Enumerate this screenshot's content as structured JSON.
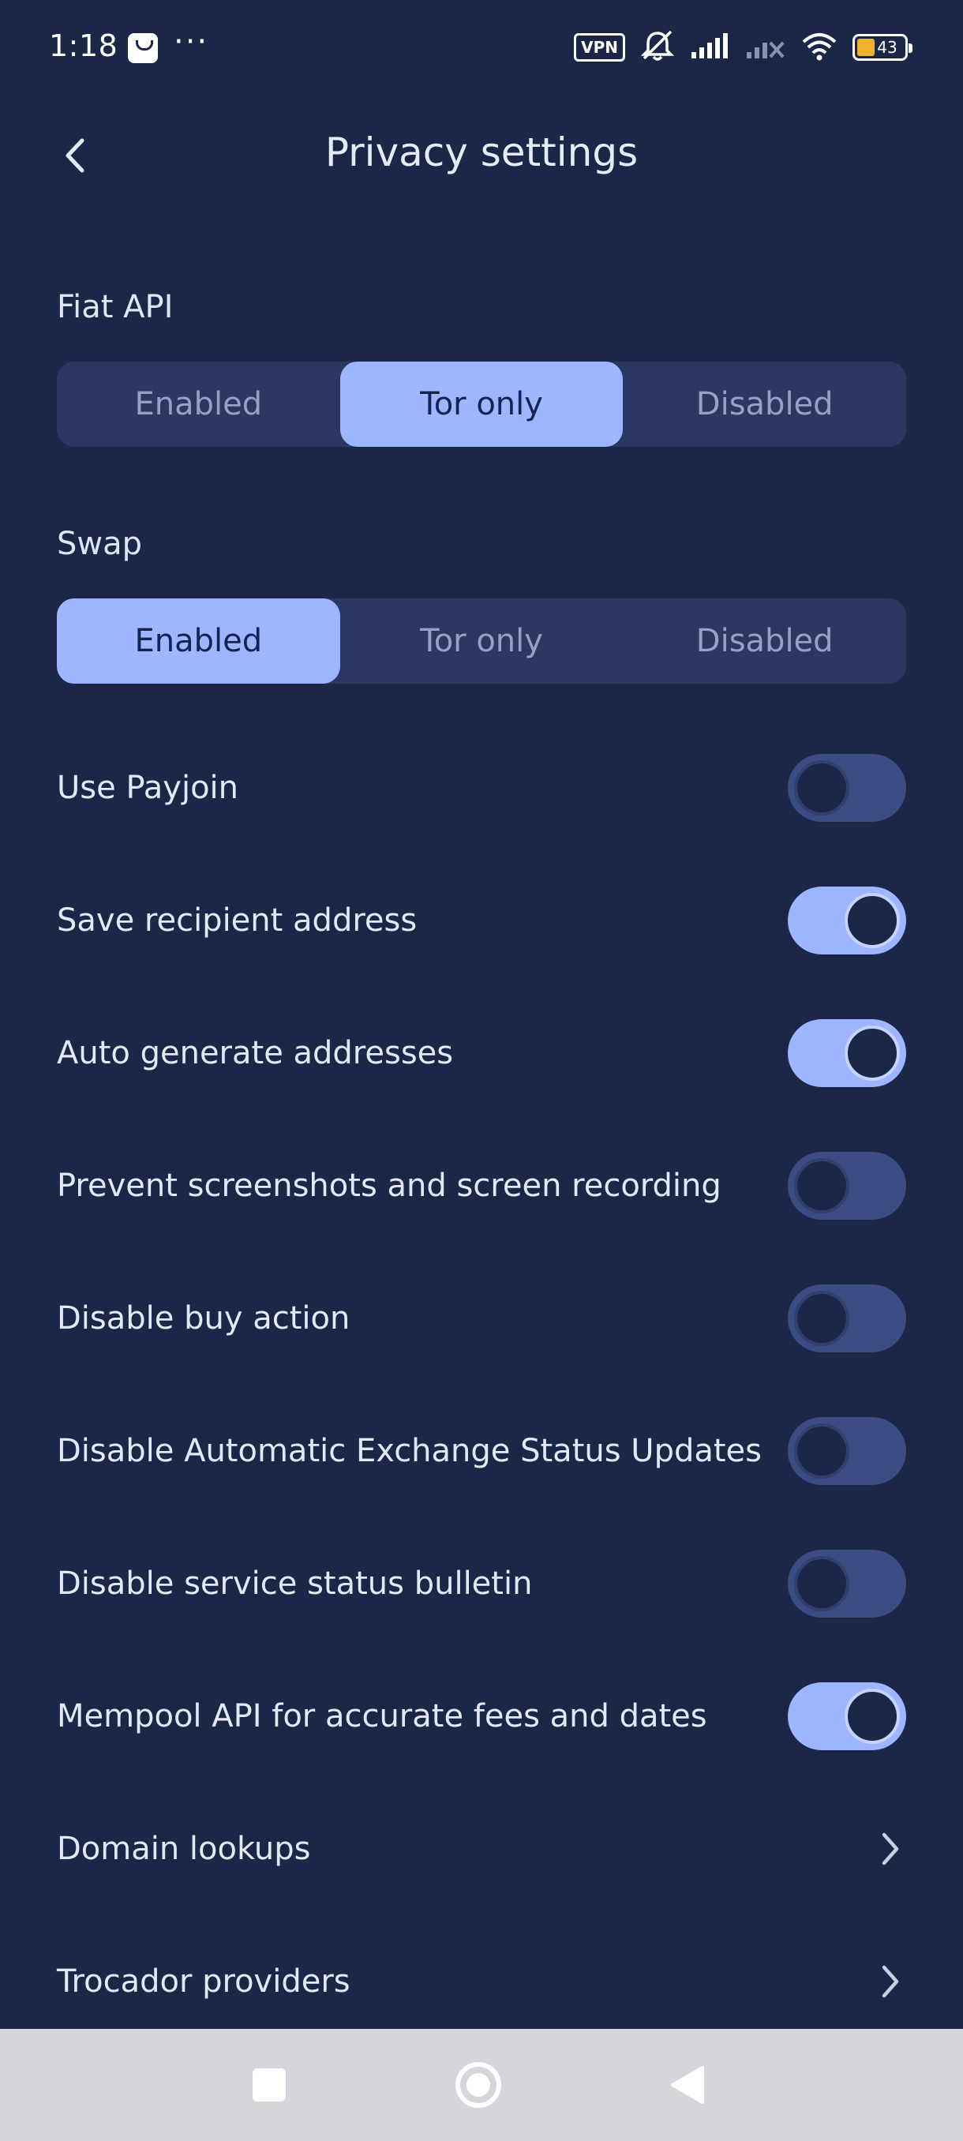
{
  "status_bar": {
    "time": "1:18",
    "dots": "···",
    "vpn_label": "VPN",
    "battery_level": "43"
  },
  "header": {
    "title": "Privacy settings"
  },
  "fiat_api": {
    "label": "Fiat API",
    "options": [
      "Enabled",
      "Tor only",
      "Disabled"
    ],
    "selected": "Tor only"
  },
  "swap": {
    "label": "Swap",
    "options": [
      "Enabled",
      "Tor only",
      "Disabled"
    ],
    "selected": "Enabled"
  },
  "toggles": [
    {
      "label": "Use Payjoin",
      "on": false
    },
    {
      "label": "Save recipient address",
      "on": true
    },
    {
      "label": "Auto generate addresses",
      "on": true
    },
    {
      "label": "Prevent screenshots and screen recording",
      "on": false
    },
    {
      "label": "Disable buy action",
      "on": false
    },
    {
      "label": "Disable Automatic Exchange Status Updates",
      "on": false
    },
    {
      "label": "Disable service status bulletin",
      "on": false
    },
    {
      "label": "Mempool API for accurate fees and dates",
      "on": true
    }
  ],
  "links": [
    {
      "label": "Domain lookups"
    },
    {
      "label": "Trocador providers"
    }
  ],
  "colors": {
    "background": "#1c2647",
    "accent": "#9db6ff",
    "segment_bg": "#2a3862",
    "toggle_off": "#3b4d82"
  }
}
